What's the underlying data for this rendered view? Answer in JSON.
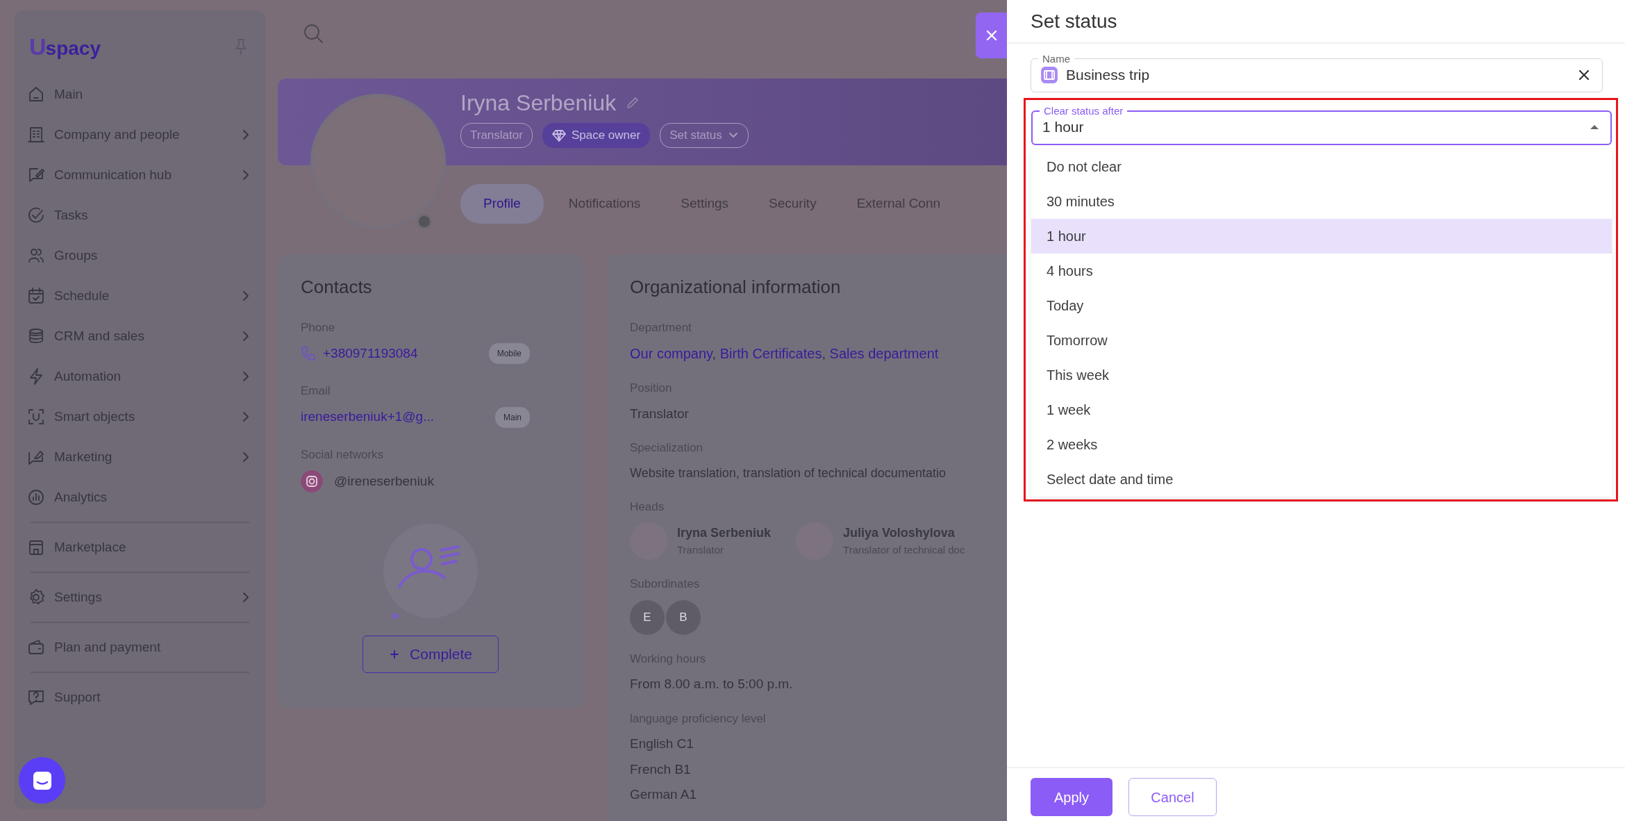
{
  "sidebar": {
    "logo": {
      "mark": "U",
      "text": "spacy"
    },
    "groups": [
      [
        {
          "label": "Main",
          "has_submenu": false
        },
        {
          "label": "Company and people",
          "has_submenu": true
        },
        {
          "label": "Communication hub",
          "has_submenu": true
        },
        {
          "label": "Tasks",
          "has_submenu": false
        },
        {
          "label": "Groups",
          "has_submenu": false
        },
        {
          "label": "Schedule",
          "has_submenu": true
        },
        {
          "label": "CRM and sales",
          "has_submenu": true
        },
        {
          "label": "Automation",
          "has_submenu": true
        },
        {
          "label": "Smart objects",
          "has_submenu": true
        },
        {
          "label": "Marketing",
          "has_submenu": true
        },
        {
          "label": "Analytics",
          "has_submenu": false
        }
      ],
      [
        {
          "label": "Marketplace",
          "has_submenu": false
        }
      ],
      [
        {
          "label": "Settings",
          "has_submenu": true
        }
      ],
      [
        {
          "label": "Plan and payment",
          "has_submenu": false
        }
      ],
      [
        {
          "label": "Support",
          "has_submenu": false
        }
      ]
    ]
  },
  "profile": {
    "name": "Iryna Serbeniuk",
    "badges": [
      {
        "label": "Translator",
        "kind": "plain"
      },
      {
        "label": "Space owner",
        "kind": "owner"
      },
      {
        "label": "Set status",
        "kind": "menu"
      }
    ],
    "tabs": [
      {
        "label": "Profile",
        "selected": true
      },
      {
        "label": "Notifications",
        "selected": false
      },
      {
        "label": "Settings",
        "selected": false
      },
      {
        "label": "Security",
        "selected": false
      },
      {
        "label": "External Conn",
        "selected": false
      }
    ]
  },
  "contacts": {
    "title": "Contacts",
    "phone": {
      "label": "Phone",
      "value": "+380971193084",
      "tag": "Mobile"
    },
    "email": {
      "label": "Email",
      "value": "ireneserbeniuk+1@g...",
      "tag": "Main"
    },
    "social": {
      "label": "Social networks",
      "value": "@ireneserbeniuk"
    },
    "complete_button": "Complete"
  },
  "org": {
    "title": "Organizational information",
    "fields": [
      {
        "label": "Department",
        "kind": "links",
        "separator": ",",
        "values": [
          "Our company",
          "Birth Certificates",
          "Sales department"
        ]
      },
      {
        "label": "Position",
        "kind": "text",
        "lines": [
          "Translator"
        ]
      },
      {
        "label": "Specialization",
        "kind": "text",
        "lines": [
          "Website translation, translation of technical documentatio"
        ]
      },
      {
        "label": "Heads",
        "kind": "people",
        "people": [
          {
            "name": "Iryna Serbeniuk",
            "role": "Translator"
          },
          {
            "name": "Juliya Voloshylova",
            "role": "Translator of technical doc"
          }
        ]
      },
      {
        "label": "Subordinates",
        "kind": "initials",
        "initials": [
          "E",
          "B"
        ]
      },
      {
        "label": "Working hours",
        "kind": "text",
        "lines": [
          "From 8.00 a.m. to 5:00 p.m."
        ]
      },
      {
        "label": "language proficiency level",
        "kind": "text",
        "lines": [
          "English C1",
          "French B1",
          "German A1"
        ]
      }
    ]
  },
  "panel": {
    "title": "Set status",
    "name_field": {
      "label": "Name",
      "value": "Business trip"
    },
    "clear_field": {
      "label": "Clear status after",
      "value": "1 hour",
      "expanded": true,
      "highlighted": true
    },
    "options": [
      {
        "label": "Do not clear",
        "selected": false
      },
      {
        "label": "30 minutes",
        "selected": false
      },
      {
        "label": "1 hour",
        "selected": true
      },
      {
        "label": "4 hours",
        "selected": false
      },
      {
        "label": "Today",
        "selected": false
      },
      {
        "label": "Tomorrow",
        "selected": false
      },
      {
        "label": "This week",
        "selected": false
      },
      {
        "label": "1 week",
        "selected": false
      },
      {
        "label": "2 weeks",
        "selected": false
      },
      {
        "label": "Select date and time",
        "selected": false
      }
    ],
    "buttons": [
      {
        "label": "Apply",
        "kind": "primary"
      },
      {
        "label": "Cancel",
        "kind": "outline"
      }
    ]
  }
}
